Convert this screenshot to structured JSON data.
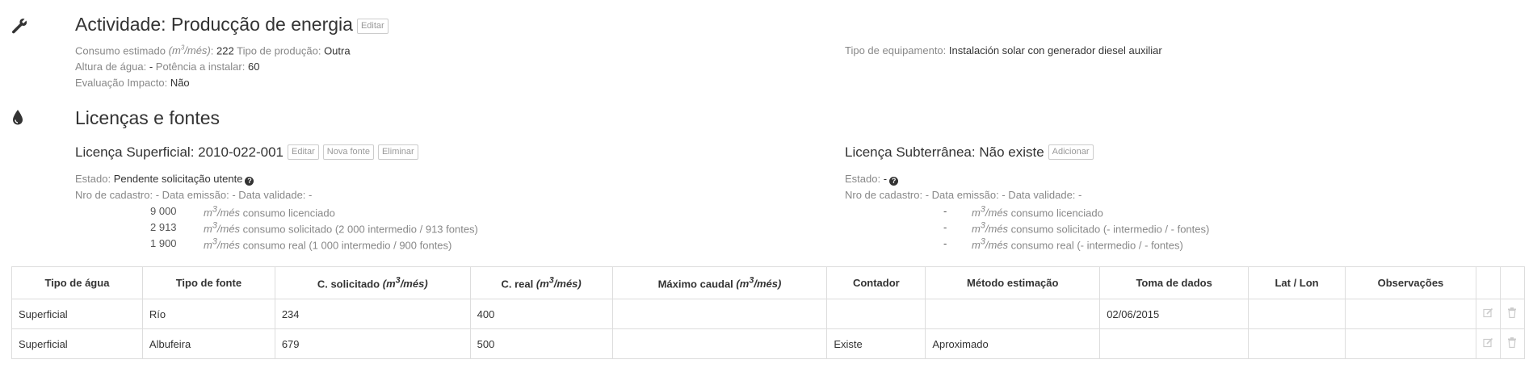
{
  "activity": {
    "title": "Actividade: Producção de energia",
    "edit_label": "Editar",
    "consumo_label": "Consumo estimado",
    "consumo_unit_pre": "m",
    "consumo_unit_post": "/més",
    "consumo_value": "222",
    "tipo_producao_label": "Tipo de produção:",
    "tipo_producao_value": "Outra",
    "altura_label": "Altura de água:",
    "altura_value": "-",
    "potencia_label": "Potência a instalar:",
    "potencia_value": "60",
    "evaluacao_label": "Evaluação Impacto:",
    "evaluacao_value": "Não",
    "tipo_equipamento_label": "Tipo de equipamento:",
    "tipo_equipamento_value": "Instalación solar con generador diesel auxiliar"
  },
  "licencas": {
    "title": "Licenças e fontes",
    "superficial": {
      "title": "Licença Superficial: 2010-022-001",
      "edit_label": "Editar",
      "nova_fonte_label": "Nova fonte",
      "eliminar_label": "Eliminar",
      "estado_label": "Estado:",
      "estado_value": "Pendente solicitação utente",
      "cadastro_line": "Nro de cadastro: - Data emissão: - Data validade: -",
      "rows": [
        {
          "num": "9 000",
          "desc": "consumo licenciado"
        },
        {
          "num": "2 913",
          "desc": "consumo solicitado (2 000 intermedio / 913 fontes)"
        },
        {
          "num": "1 900",
          "desc": "consumo real (1 000 intermedio / 900 fontes)"
        }
      ]
    },
    "subterranea": {
      "title": "Licença Subterrânea: Não existe",
      "adicionar_label": "Adicionar",
      "estado_label": "Estado:",
      "estado_value": "-",
      "cadastro_line": "Nro de cadastro: - Data emissão: - Data validade: -",
      "rows": [
        {
          "num": "-",
          "desc": "consumo licenciado"
        },
        {
          "num": "-",
          "desc": "consumo solicitado (- intermedio / - fontes)"
        },
        {
          "num": "-",
          "desc": "consumo real (- intermedio / - fontes)"
        }
      ]
    },
    "unit_m": "m",
    "unit_3": "3",
    "unit_mes": "/més"
  },
  "table": {
    "headers": {
      "tipo_agua": "Tipo de água",
      "tipo_fonte": "Tipo de fonte",
      "c_solicitado": "C. solicitado",
      "c_real": "C. real",
      "maximo_caudal": "Máximo caudal",
      "contador": "Contador",
      "metodo": "Método estimação",
      "toma_dados": "Toma de dados",
      "lat_lon": "Lat / Lon",
      "observacoes": "Observações"
    },
    "rows": [
      {
        "tipo_agua": "Superficial",
        "tipo_fonte": "Río",
        "c_solicitado": "234",
        "c_real": "400",
        "maximo_caudal": "",
        "contador": "",
        "metodo": "",
        "toma_dados": "02/06/2015",
        "lat_lon": "",
        "observacoes": ""
      },
      {
        "tipo_agua": "Superficial",
        "tipo_fonte": "Albufeira",
        "c_solicitado": "679",
        "c_real": "500",
        "maximo_caudal": "",
        "contador": "Existe",
        "metodo": "Aproximado",
        "toma_dados": "",
        "lat_lon": "",
        "observacoes": ""
      }
    ]
  }
}
